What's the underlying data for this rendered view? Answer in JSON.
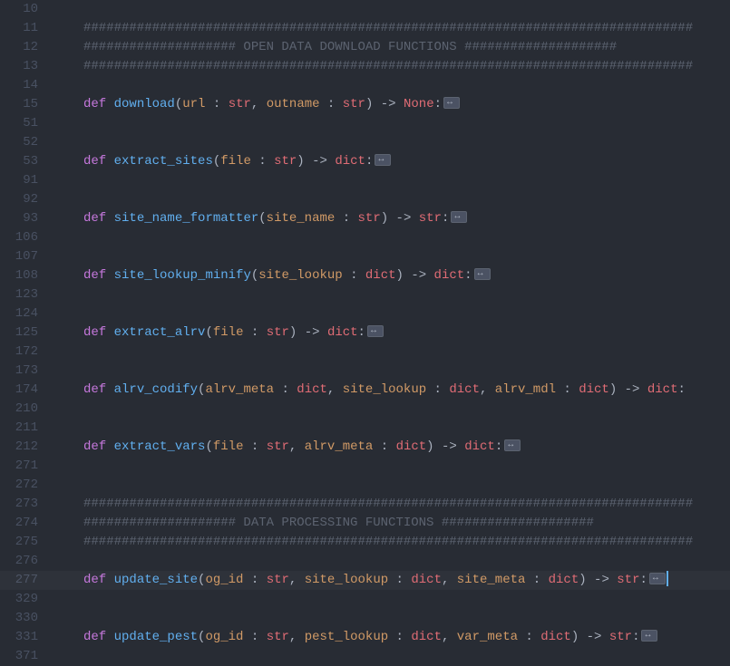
{
  "lineNumbers": [
    "10",
    "11",
    "12",
    "13",
    "14",
    "15",
    "51",
    "52",
    "53",
    "91",
    "92",
    "93",
    "106",
    "107",
    "108",
    "123",
    "124",
    "125",
    "172",
    "173",
    "174",
    "210",
    "211",
    "212",
    "271",
    "272",
    "273",
    "274",
    "275",
    "276",
    "277",
    "329",
    "330",
    "331",
    "371"
  ],
  "highlightedLine": 30,
  "lines": [
    {
      "tokens": []
    },
    {
      "tokens": [
        {
          "t": "cm",
          "v": "################################################################################"
        }
      ]
    },
    {
      "tokens": [
        {
          "t": "cm",
          "v": "#################### OPEN DATA DOWNLOAD FUNCTIONS ####################"
        }
      ]
    },
    {
      "tokens": [
        {
          "t": "cm",
          "v": "################################################################################"
        }
      ]
    },
    {
      "tokens": []
    },
    {
      "tokens": [
        {
          "t": "kw",
          "v": "def"
        },
        {
          "t": "sp",
          "v": " "
        },
        {
          "t": "fn",
          "v": "download"
        },
        {
          "t": "pn",
          "v": "("
        },
        {
          "t": "pr",
          "v": "url"
        },
        {
          "t": "pn",
          "v": " : "
        },
        {
          "t": "ty",
          "v": "str"
        },
        {
          "t": "pn",
          "v": ", "
        },
        {
          "t": "pr",
          "v": "outname"
        },
        {
          "t": "pn",
          "v": " : "
        },
        {
          "t": "ty",
          "v": "str"
        },
        {
          "t": "pn",
          "v": ") "
        },
        {
          "t": "op",
          "v": "->"
        },
        {
          "t": "pn",
          "v": " "
        },
        {
          "t": "ty",
          "v": "None"
        },
        {
          "t": "pn",
          "v": ":"
        },
        {
          "t": "fold"
        }
      ]
    },
    {
      "tokens": []
    },
    {
      "tokens": []
    },
    {
      "tokens": [
        {
          "t": "kw",
          "v": "def"
        },
        {
          "t": "sp",
          "v": " "
        },
        {
          "t": "fn",
          "v": "extract_sites"
        },
        {
          "t": "pn",
          "v": "("
        },
        {
          "t": "pr",
          "v": "file"
        },
        {
          "t": "pn",
          "v": " : "
        },
        {
          "t": "ty",
          "v": "str"
        },
        {
          "t": "pn",
          "v": ") "
        },
        {
          "t": "op",
          "v": "->"
        },
        {
          "t": "pn",
          "v": " "
        },
        {
          "t": "ty",
          "v": "dict"
        },
        {
          "t": "pn",
          "v": ":"
        },
        {
          "t": "fold"
        }
      ]
    },
    {
      "tokens": []
    },
    {
      "tokens": []
    },
    {
      "tokens": [
        {
          "t": "kw",
          "v": "def"
        },
        {
          "t": "sp",
          "v": " "
        },
        {
          "t": "fn",
          "v": "site_name_formatter"
        },
        {
          "t": "pn",
          "v": "("
        },
        {
          "t": "pr",
          "v": "site_name"
        },
        {
          "t": "pn",
          "v": " : "
        },
        {
          "t": "ty",
          "v": "str"
        },
        {
          "t": "pn",
          "v": ") "
        },
        {
          "t": "op",
          "v": "->"
        },
        {
          "t": "pn",
          "v": " "
        },
        {
          "t": "ty",
          "v": "str"
        },
        {
          "t": "pn",
          "v": ":"
        },
        {
          "t": "fold"
        }
      ]
    },
    {
      "tokens": []
    },
    {
      "tokens": []
    },
    {
      "tokens": [
        {
          "t": "kw",
          "v": "def"
        },
        {
          "t": "sp",
          "v": " "
        },
        {
          "t": "fn",
          "v": "site_lookup_minify"
        },
        {
          "t": "pn",
          "v": "("
        },
        {
          "t": "pr",
          "v": "site_lookup"
        },
        {
          "t": "pn",
          "v": " : "
        },
        {
          "t": "ty",
          "v": "dict"
        },
        {
          "t": "pn",
          "v": ") "
        },
        {
          "t": "op",
          "v": "->"
        },
        {
          "t": "pn",
          "v": " "
        },
        {
          "t": "ty",
          "v": "dict"
        },
        {
          "t": "pn",
          "v": ":"
        },
        {
          "t": "fold"
        }
      ]
    },
    {
      "tokens": []
    },
    {
      "tokens": []
    },
    {
      "tokens": [
        {
          "t": "kw",
          "v": "def"
        },
        {
          "t": "sp",
          "v": " "
        },
        {
          "t": "fn",
          "v": "extract_alrv"
        },
        {
          "t": "pn",
          "v": "("
        },
        {
          "t": "pr",
          "v": "file"
        },
        {
          "t": "pn",
          "v": " : "
        },
        {
          "t": "ty",
          "v": "str"
        },
        {
          "t": "pn",
          "v": ") "
        },
        {
          "t": "op",
          "v": "->"
        },
        {
          "t": "pn",
          "v": " "
        },
        {
          "t": "ty",
          "v": "dict"
        },
        {
          "t": "pn",
          "v": ":"
        },
        {
          "t": "fold"
        }
      ]
    },
    {
      "tokens": []
    },
    {
      "tokens": []
    },
    {
      "tokens": [
        {
          "t": "kw",
          "v": "def"
        },
        {
          "t": "sp",
          "v": " "
        },
        {
          "t": "fn",
          "v": "alrv_codify"
        },
        {
          "t": "pn",
          "v": "("
        },
        {
          "t": "pr",
          "v": "alrv_meta"
        },
        {
          "t": "pn",
          "v": " : "
        },
        {
          "t": "ty",
          "v": "dict"
        },
        {
          "t": "pn",
          "v": ", "
        },
        {
          "t": "pr",
          "v": "site_lookup"
        },
        {
          "t": "pn",
          "v": " : "
        },
        {
          "t": "ty",
          "v": "dict"
        },
        {
          "t": "pn",
          "v": ", "
        },
        {
          "t": "pr",
          "v": "alrv_mdl"
        },
        {
          "t": "pn",
          "v": " : "
        },
        {
          "t": "ty",
          "v": "dict"
        },
        {
          "t": "pn",
          "v": ") "
        },
        {
          "t": "op",
          "v": "->"
        },
        {
          "t": "pn",
          "v": " "
        },
        {
          "t": "ty",
          "v": "dict"
        },
        {
          "t": "pn",
          "v": ":"
        }
      ]
    },
    {
      "tokens": []
    },
    {
      "tokens": []
    },
    {
      "tokens": [
        {
          "t": "kw",
          "v": "def"
        },
        {
          "t": "sp",
          "v": " "
        },
        {
          "t": "fn",
          "v": "extract_vars"
        },
        {
          "t": "pn",
          "v": "("
        },
        {
          "t": "pr",
          "v": "file"
        },
        {
          "t": "pn",
          "v": " : "
        },
        {
          "t": "ty",
          "v": "str"
        },
        {
          "t": "pn",
          "v": ", "
        },
        {
          "t": "pr",
          "v": "alrv_meta"
        },
        {
          "t": "pn",
          "v": " : "
        },
        {
          "t": "ty",
          "v": "dict"
        },
        {
          "t": "pn",
          "v": ") "
        },
        {
          "t": "op",
          "v": "->"
        },
        {
          "t": "pn",
          "v": " "
        },
        {
          "t": "ty",
          "v": "dict"
        },
        {
          "t": "pn",
          "v": ":"
        },
        {
          "t": "fold"
        }
      ]
    },
    {
      "tokens": []
    },
    {
      "tokens": []
    },
    {
      "tokens": [
        {
          "t": "cm",
          "v": "################################################################################"
        }
      ]
    },
    {
      "tokens": [
        {
          "t": "cm",
          "v": "#################### DATA PROCESSING FUNCTIONS ####################"
        }
      ]
    },
    {
      "tokens": [
        {
          "t": "cm",
          "v": "################################################################################"
        }
      ]
    },
    {
      "tokens": []
    },
    {
      "tokens": [
        {
          "t": "kw",
          "v": "def"
        },
        {
          "t": "sp",
          "v": " "
        },
        {
          "t": "fn",
          "v": "update_site"
        },
        {
          "t": "pn",
          "v": "("
        },
        {
          "t": "pr",
          "v": "og_id"
        },
        {
          "t": "pn",
          "v": " : "
        },
        {
          "t": "ty",
          "v": "str"
        },
        {
          "t": "pn",
          "v": ", "
        },
        {
          "t": "pr",
          "v": "site_lookup"
        },
        {
          "t": "pn",
          "v": " : "
        },
        {
          "t": "ty",
          "v": "dict"
        },
        {
          "t": "pn",
          "v": ", "
        },
        {
          "t": "pr",
          "v": "site_meta"
        },
        {
          "t": "pn",
          "v": " : "
        },
        {
          "t": "ty",
          "v": "dict"
        },
        {
          "t": "pn",
          "v": ") "
        },
        {
          "t": "op",
          "v": "->"
        },
        {
          "t": "pn",
          "v": " "
        },
        {
          "t": "ty",
          "v": "str"
        },
        {
          "t": "pn",
          "v": ":"
        },
        {
          "t": "fold"
        },
        {
          "t": "cursor"
        }
      ]
    },
    {
      "tokens": []
    },
    {
      "tokens": []
    },
    {
      "tokens": [
        {
          "t": "kw",
          "v": "def"
        },
        {
          "t": "sp",
          "v": " "
        },
        {
          "t": "fn",
          "v": "update_pest"
        },
        {
          "t": "pn",
          "v": "("
        },
        {
          "t": "pr",
          "v": "og_id"
        },
        {
          "t": "pn",
          "v": " : "
        },
        {
          "t": "ty",
          "v": "str"
        },
        {
          "t": "pn",
          "v": ", "
        },
        {
          "t": "pr",
          "v": "pest_lookup"
        },
        {
          "t": "pn",
          "v": " : "
        },
        {
          "t": "ty",
          "v": "dict"
        },
        {
          "t": "pn",
          "v": ", "
        },
        {
          "t": "pr",
          "v": "var_meta"
        },
        {
          "t": "pn",
          "v": " : "
        },
        {
          "t": "ty",
          "v": "dict"
        },
        {
          "t": "pn",
          "v": ") "
        },
        {
          "t": "op",
          "v": "->"
        },
        {
          "t": "pn",
          "v": " "
        },
        {
          "t": "ty",
          "v": "str"
        },
        {
          "t": "pn",
          "v": ":"
        },
        {
          "t": "fold"
        }
      ]
    },
    {
      "tokens": []
    }
  ]
}
